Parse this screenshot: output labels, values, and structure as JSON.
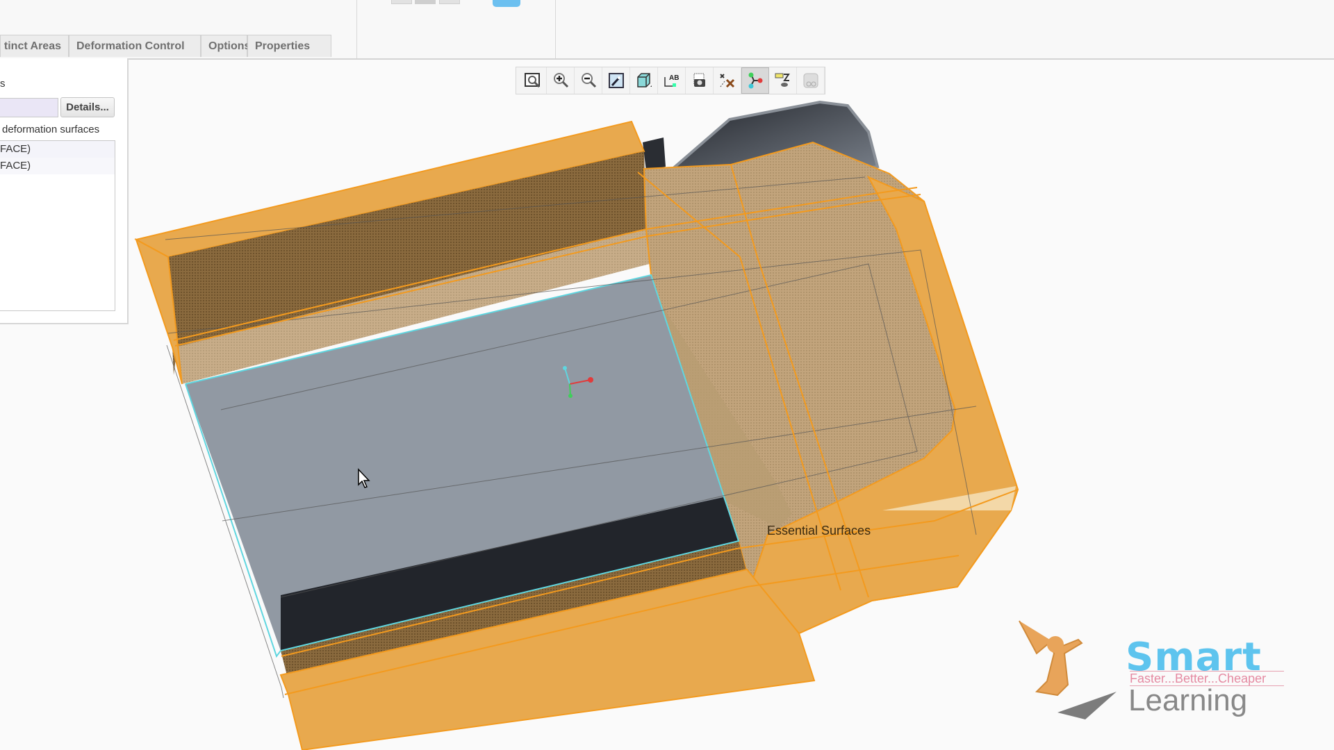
{
  "tabs": [
    {
      "label": "Distinct Areas",
      "visible_label": "tinct Areas"
    },
    {
      "label": "Deformation Control"
    },
    {
      "label": "Options"
    },
    {
      "label": "Properties"
    }
  ],
  "panel": {
    "section_label_fragment": "s",
    "collector_value": "",
    "details_button": "Details...",
    "list_label": "deformation surfaces",
    "list_items": [
      "FACE)",
      "FACE)"
    ]
  },
  "toolbar": {
    "buttons": [
      {
        "name": "refit-icon",
        "tooltip": "Refit"
      },
      {
        "name": "zoom-in-icon",
        "tooltip": "Zoom In"
      },
      {
        "name": "zoom-out-icon",
        "tooltip": "Zoom Out"
      },
      {
        "name": "repaint-icon",
        "tooltip": "Repaint"
      },
      {
        "name": "display-style-icon",
        "tooltip": "Display Style"
      },
      {
        "name": "annotation-display-icon",
        "tooltip": "Annotation Display"
      },
      {
        "name": "saved-orientations-icon",
        "tooltip": "Saved Orientations"
      },
      {
        "name": "datum-display-icon",
        "tooltip": "Datum Display Filters"
      },
      {
        "name": "spin-center-icon",
        "tooltip": "Spin Center",
        "active": true
      },
      {
        "name": "view-manager-icon",
        "tooltip": "View Manager"
      },
      {
        "name": "appearance-gallery-icon",
        "tooltip": "Appearance",
        "disabled": true
      }
    ]
  },
  "viewport": {
    "model_label": "Essential Surfaces",
    "colors": {
      "deformation_orange": "#e8a94e",
      "deformation_edge": "#f39a1e",
      "face_gray": "#9199a3",
      "dark_band": "#22252b",
      "selection_cyan": "#5fd6e0",
      "triad_x": "#e23b3b",
      "triad_y": "#3fcf5a",
      "triad_z": "#5fd6e0"
    }
  },
  "watermark": {
    "title": "Smart",
    "tagline": "Faster...Better...Cheaper",
    "subtitle": "Learning",
    "colors": {
      "title": "#5ec4ee",
      "tagline": "#e58aa2",
      "subtitle": "#888888"
    }
  }
}
